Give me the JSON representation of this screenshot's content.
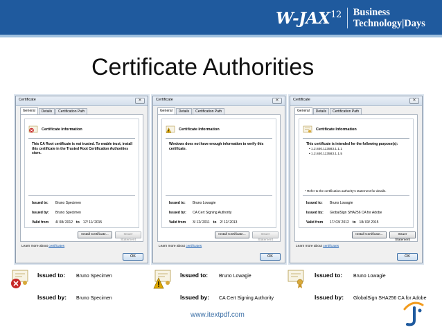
{
  "header": {
    "logo_main": "W-JAX",
    "logo_sub": "12",
    "brand_line1": "Business",
    "brand_line2": "Technology|Days"
  },
  "slide_title": "Certificate Authorities",
  "dialog_common": {
    "window_title": "Certificate",
    "close_label": "✕",
    "tabs": [
      "General",
      "Details",
      "Certification Path"
    ],
    "info_title": "Certificate Information",
    "issued_to_label": "Issued to:",
    "issued_by_label": "Issued by:",
    "valid_from_label": "Valid from",
    "to_label": "to",
    "install_button": "Install Certificate...",
    "issuer_button": "Issuer Statement",
    "learn_more": "Learn more about",
    "learn_link": "certificates",
    "ok_button": "OK"
  },
  "dialogs": [
    {
      "message": "This CA Root certificate is not trusted. To enable trust, install this certificate in the Trusted Root Certification Authorities store.",
      "issued_to": "Bruno Specimen",
      "issued_by": "Bruno Specimen",
      "valid_from": "4/ 08/ 2012",
      "valid_to": "17/ 11/ 2015",
      "status": "error"
    },
    {
      "message": "Windows does not have enough information to verify this certificate.",
      "issued_to": "Bruno Lowagie",
      "issued_by": "CA Cert Signing Authority",
      "valid_from": "3/ 12/ 2011",
      "valid_to": "2/ 12/ 2013",
      "status": "warning"
    },
    {
      "message": "This certificate is intended for the following purpose(s):",
      "purposes": [
        "• 1.2.840.113583.1.1.1",
        "• 1.2.840.113583.1.1.5"
      ],
      "refer_note": "* Refer to the certification authority's statement for details.",
      "issued_to": "Bruno Lowagie",
      "issued_by": "GlobalSign SHA256 CA for Adobe",
      "valid_from": "17/ 03/ 2012",
      "valid_to": "18/ 03/ 2015",
      "status": "ok"
    }
  ],
  "summaries": [
    {
      "issued_to": "Bruno Specimen",
      "issued_by": "Bruno Specimen",
      "icon": "cert-error-icon"
    },
    {
      "issued_to": "Bruno Lowagie",
      "issued_by": "CA Cert Signing Authority",
      "icon": "cert-warning-icon"
    },
    {
      "issued_to": "Bruno Lowagie",
      "issued_by": "GlobalSign SHA256 CA for Adobe",
      "icon": "cert-ok-icon"
    }
  ],
  "summary_labels": {
    "issued_to": "Issued to:",
    "issued_by": "Issued by:"
  },
  "footer_url": "www.itextpdf.com",
  "colors": {
    "header_bg": "#1f5a9e",
    "header_stripe": "#9fc0de",
    "link": "#1a5fb4",
    "footer_url": "#3a6ea5",
    "error": "#c62828",
    "warning": "#e0a800"
  }
}
